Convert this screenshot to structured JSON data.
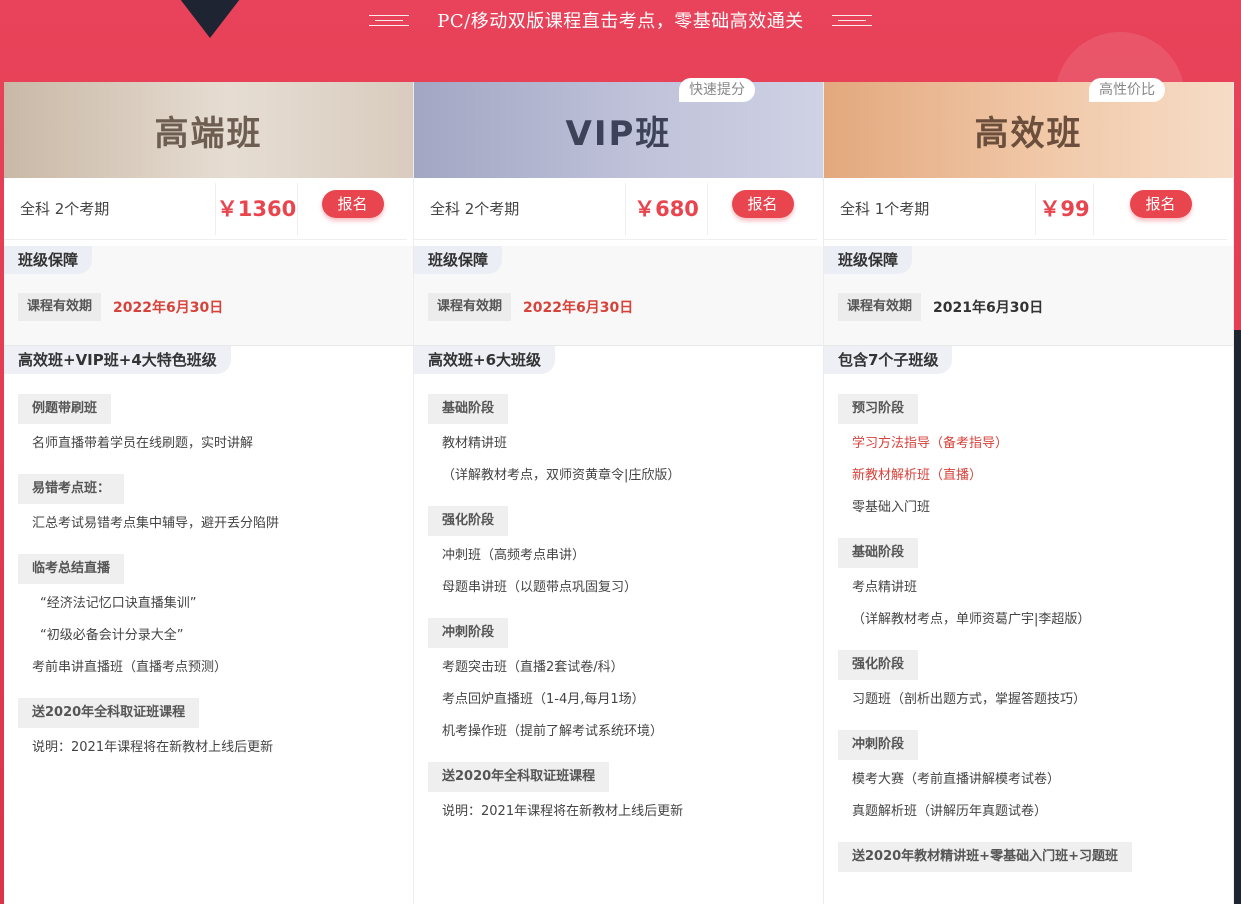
{
  "headline": "PC/移动双版课程直击考点，零基础高效通关",
  "columns": [
    {
      "title": "高端班",
      "badge": "",
      "desc": "全科 2个考期",
      "price": "￥1360",
      "register_label": "报名",
      "guard_title": "班级保障",
      "valid_label": "课程有效期",
      "valid_date": "2022年6月30日",
      "courses_title": "高效班+VIP班+4大特色班级",
      "blocks": [
        {
          "stage": "例题带刷班",
          "items": [
            "名师直播带着学员在线刷题，实时讲解"
          ]
        },
        {
          "stage": "易错考点班：",
          "items": [
            "汇总考试易错考点集中辅导，避开丢分陷阱"
          ]
        },
        {
          "stage": "临考总结直播",
          "items": [
            "“经济法记忆口诀直播集训”",
            "“初级必备会计分录大全”",
            "考前串讲直播班（直播考点预测）"
          ]
        },
        {
          "stage": "送2020年全科取证班课程",
          "items": [
            "说明：2021年课程将在新教材上线后更新"
          ]
        }
      ]
    },
    {
      "title": "VIP班",
      "badge": "快速提分",
      "desc": "全科 2个考期",
      "price": "￥680",
      "register_label": "报名",
      "guard_title": "班级保障",
      "valid_label": "课程有效期",
      "valid_date": "2022年6月30日",
      "courses_title": "高效班+6大班级",
      "blocks": [
        {
          "stage": "基础阶段",
          "items": [
            "教材精讲班",
            "（详解教材考点，双师资黄章令|庄欣版）"
          ]
        },
        {
          "stage": "强化阶段",
          "items": [
            "冲刺班（高频考点串讲）",
            "母题串讲班（以题带点巩固复习）"
          ]
        },
        {
          "stage": "冲刺阶段",
          "items": [
            "考题突击班（直播2套试卷/科）",
            "考点回炉直播班（1-4月,每月1场）",
            "机考操作班（提前了解考试系统环境）"
          ]
        },
        {
          "stage": "送2020年全科取证班课程",
          "items": [
            "说明：2021年课程将在新教材上线后更新"
          ]
        }
      ]
    },
    {
      "title": "高效班",
      "badge": "高性价比",
      "desc": "全科 1个考期",
      "price": "￥99",
      "register_label": "报名",
      "guard_title": "班级保障",
      "valid_label": "课程有效期",
      "valid_date": "2021年6月30日",
      "courses_title": "包含7个子班级",
      "blocks": [
        {
          "stage": "预习阶段",
          "items": [
            "学习方法指导（备考指导）",
            "新教材解析班（直播）",
            "零基础入门班"
          ]
        },
        {
          "stage": "基础阶段",
          "items": [
            "考点精讲班",
            "（详解教材考点，单师资葛广宇|李超版）"
          ]
        },
        {
          "stage": "强化阶段",
          "items": [
            "习题班（剖析出题方式，掌握答题技巧）"
          ]
        },
        {
          "stage": "冲刺阶段",
          "items": [
            "模考大赛（考前直播讲解模考试卷）",
            "真题解析班（讲解历年真题试卷）"
          ]
        },
        {
          "stage": "送2020年教材精讲班+零基础入门班+习题班",
          "items": []
        }
      ]
    }
  ],
  "colors": {
    "brand_red": "#e8454f",
    "header_bg": "#e23a52",
    "date_red": "#d6433b"
  }
}
